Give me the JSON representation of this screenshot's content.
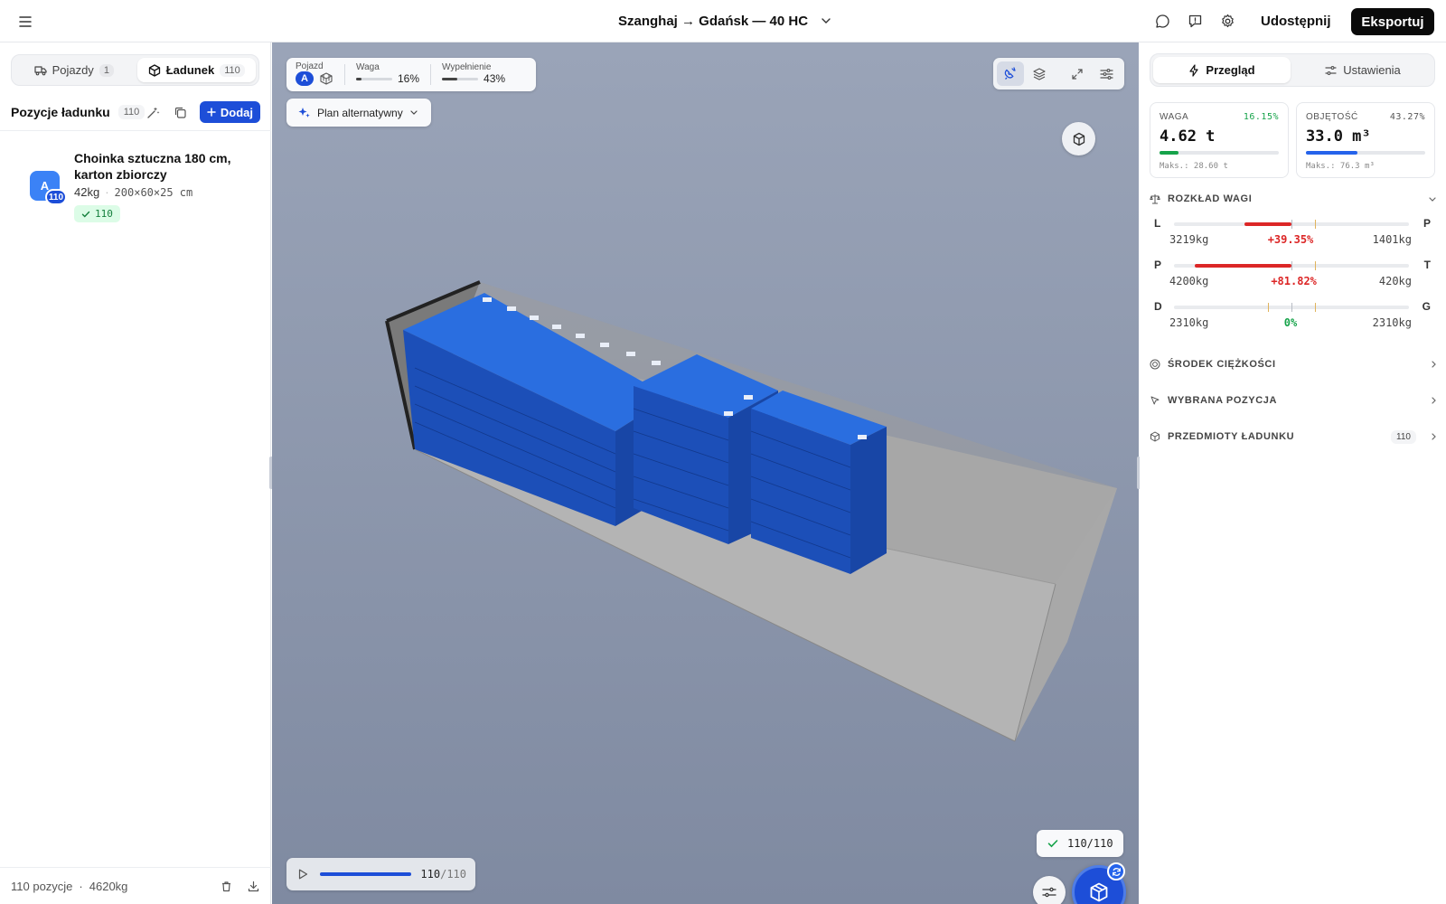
{
  "header": {
    "title": "Szanghaj → Gdańsk — 40 HC",
    "share_label": "Udostępnij",
    "export_label": "Eksportuj"
  },
  "left": {
    "tabs": [
      {
        "label": "Pojazdy",
        "count": "1",
        "icon": "truck-icon",
        "active": false
      },
      {
        "label": "Ładunek",
        "count": "110",
        "icon": "box-icon",
        "active": true
      }
    ],
    "list_title": "Pozycje ładunku",
    "list_count": "110",
    "add_label": "Dodaj",
    "items": [
      {
        "avatar": "A",
        "badge": "110",
        "name": "Choinka sztuczna 180 cm, karton zbiorczy",
        "weight": "42kg",
        "dims": "200×60×25 cm",
        "placed": "110"
      }
    ],
    "footer": {
      "positions": "110 pozycje",
      "weight": "4620kg"
    }
  },
  "viewport": {
    "vehicle_label": "Pojazd",
    "vehicle_letter": "A",
    "weight_label": "Waga",
    "weight_value": "16%",
    "weight_fraction": 0.16,
    "fill_label": "Wypełnienie",
    "fill_value": "43%",
    "fill_fraction": 0.43,
    "plan_label": "Plan alternatywny",
    "placed_status": "110/110",
    "player_current": "110",
    "player_total": "/110",
    "player_progress": 1.0,
    "accent_color": "#1d4ed8",
    "cargo_color": "#1f63d6"
  },
  "right": {
    "tabs": [
      {
        "label": "Przegląd",
        "active": true
      },
      {
        "label": "Ustawienia",
        "active": false
      }
    ],
    "weight_card": {
      "label": "WAGA",
      "pct": "16.15%",
      "value": "4.62 t",
      "max": "Maks.: 28.60 t",
      "fraction": 0.1615,
      "color": "#16a34a"
    },
    "volume_card": {
      "label": "OBJĘTOŚĆ",
      "pct": "43.27%",
      "value": "33.0 m³",
      "max": "Maks.: 76.3 m³",
      "fraction": 0.4327,
      "color": "#2563eb"
    },
    "distribution_title": "ROZKŁAD WAGI",
    "balances": [
      {
        "left": "L",
        "right": "P",
        "left_value": "3219kg",
        "pct": "+39.35%",
        "right_value": "1401kg",
        "color": "#dc2626",
        "from": 0.3,
        "to": 0.5
      },
      {
        "left": "P",
        "right": "T",
        "left_value": "4200kg",
        "pct": "+81.82%",
        "right_value": "420kg",
        "color": "#dc2626",
        "from": 0.09,
        "to": 0.5
      },
      {
        "left": "D",
        "right": "G",
        "left_value": "2310kg",
        "pct": "0%",
        "right_value": "2310kg",
        "color": "#16a34a",
        "from": 0.5,
        "to": 0.5
      }
    ],
    "sections": [
      {
        "title": "ŚRODEK CIĘŻKOŚCI",
        "count": ""
      },
      {
        "title": "WYBRANA POZYCJA",
        "count": ""
      },
      {
        "title": "PRZEDMIOTY ŁADUNKU",
        "count": "110"
      }
    ]
  }
}
